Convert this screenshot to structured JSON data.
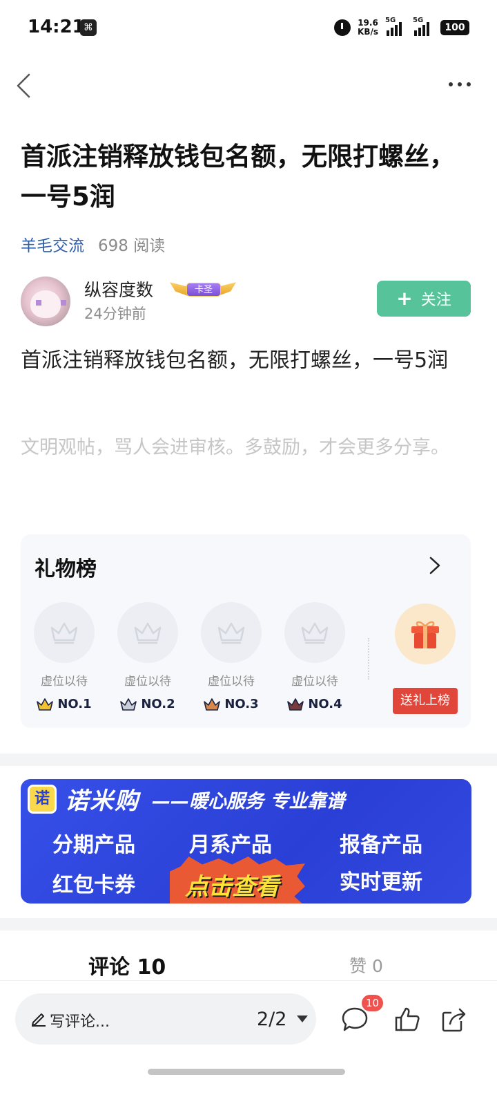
{
  "status_bar": {
    "time": "14:21",
    "app_icon_glyph": "⌘",
    "net_speed_top": "19.6",
    "net_speed_bottom": "KB/s",
    "signal1_tag": "5G",
    "signal2_tag": "5G",
    "battery": "100",
    "icons": [
      "app-notification-icon",
      "alarm-icon",
      "signal-icon",
      "battery-icon"
    ]
  },
  "nav": {
    "icons": [
      "back-icon",
      "more-icon"
    ]
  },
  "post": {
    "title": "首派注销释放钱包名额，无限打螺丝，一号5润",
    "section": "羊毛交流",
    "reads": "698 阅读",
    "author": {
      "name": "纵容度数",
      "badge": "卡圣",
      "time": "24分钟前",
      "follow_label": "关注"
    },
    "body": "首派注销释放钱包名额，无限打螺丝，一号5润",
    "hint": "文明观帖，骂人会进审核。多鼓励，才会更多分享。"
  },
  "gift_board": {
    "title": "礼物榜",
    "slots": [
      {
        "placeholder": "虚位以待",
        "rank": "NO.1",
        "crown_color": "#f2c230"
      },
      {
        "placeholder": "虚位以待",
        "rank": "NO.2",
        "crown_color": "#c9ced8"
      },
      {
        "placeholder": "虚位以待",
        "rank": "NO.3",
        "crown_color": "#d9884a"
      },
      {
        "placeholder": "虚位以待",
        "rank": "NO.4",
        "crown_color": "#7a3b3b"
      }
    ],
    "send_label": "送礼上榜"
  },
  "banner": {
    "logo": "诺",
    "brand": "诺米购",
    "slogan": "——暖心服务 专业靠谱",
    "items": [
      "分期产品",
      "月系产品",
      "报备产品",
      "红包卡券",
      "实时更新"
    ],
    "cta": "点击查看"
  },
  "tabs": {
    "comments": "评论 10",
    "likes": "赞 0"
  },
  "bottom_bar": {
    "placeholder": "写评论...",
    "page": "2/2",
    "comment_count": "10"
  },
  "colors": {
    "accent_green": "#56c39a",
    "link_blue": "#2f5ea8",
    "gift_red": "#e0473a",
    "badge_red": "#ef5350",
    "banner_blue": "#2a3fd5"
  }
}
